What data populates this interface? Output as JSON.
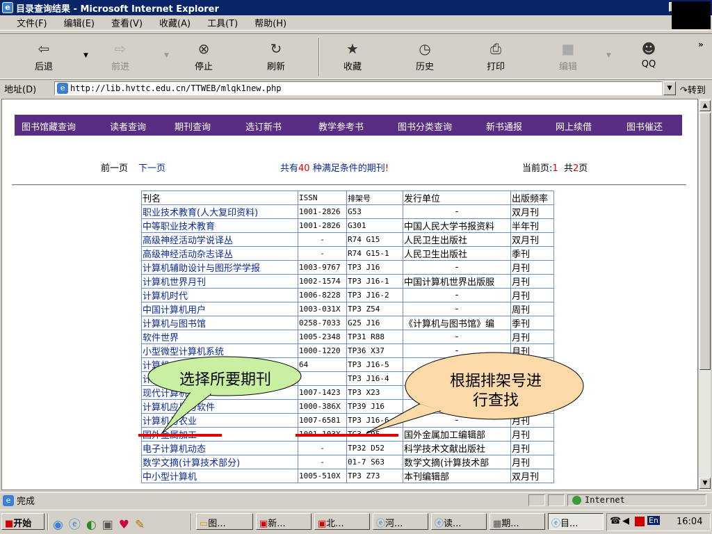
{
  "window": {
    "title": "目录查询结果 - Microsoft Internet Explorer",
    "btn_min": "_",
    "btn_max": "□",
    "btn_close": "×"
  },
  "menu": [
    "文件(F)",
    "编辑(E)",
    "查看(V)",
    "收藏(A)",
    "工具(T)",
    "帮助(H)"
  ],
  "toolbar": {
    "back": "后退",
    "forward": "前进",
    "stop": "停止",
    "refresh": "刷新",
    "favorites": "收藏",
    "history": "历史",
    "print": "打印",
    "edit": "编辑",
    "qq": "QQ",
    "more": "»"
  },
  "address": {
    "label": "地址(D)",
    "url": "http://lib.hvttc.edu.cn/TTWEB/mlqk1new.php",
    "go": "转到"
  },
  "nav": [
    "图书馆藏查询",
    "读者查询",
    "期刊查询",
    "选订新书",
    "教学参考书",
    "图书分类查询",
    "新书通报",
    "网上续借",
    "图书催还"
  ],
  "pager": {
    "prev": "前一页",
    "next": "下一页",
    "summary_pre": "共有",
    "summary_count": "40",
    "summary_post": " 种满足条件的期刊",
    "summary_mark": "!",
    "current_label": "当前页:",
    "current_page": "1",
    "total_pre": "共",
    "total_pages": "2",
    "total_post": "页"
  },
  "table": {
    "headers": [
      "刊名",
      "ISSN",
      "排架号",
      "发行单位",
      "出版频率"
    ],
    "rows": [
      [
        "职业技术教育(人大复印资料)",
        "1001-2826",
        "G53",
        "-",
        "双月刊"
      ],
      [
        "中等职业技术教育",
        "1001-2826",
        "G301",
        "中国人民大学书报资料",
        "半年刊"
      ],
      [
        "高级神经活动学说译丛",
        "-",
        "R74 G15",
        "人民卫生出版社",
        "双月刊"
      ],
      [
        "高级神经活动杂志译丛",
        "-",
        "R74 G15-1",
        "人民卫生出版社",
        "季刊"
      ],
      [
        "计算机辅助设计与图形学学报",
        "1003-9767",
        "TP3 J16",
        "-",
        "月刊"
      ],
      [
        "计算机世界月刊",
        "1002-1574",
        "TP3 J16-1",
        "中国计算机世界出版服",
        "月刊"
      ],
      [
        "计算机时代",
        "1006-8228",
        "TP3 J16-2",
        "-",
        "月刊"
      ],
      [
        "中国计算机用户",
        "1003-031X",
        "TP3 Z54",
        "-",
        "周刊"
      ],
      [
        "计算机与图书馆",
        "0258-7033",
        "G25 J16",
        "《计算机与图书馆》编",
        "季刊"
      ],
      [
        "软件世界",
        "1005-2348",
        "TP31 R88",
        "-",
        "月刊"
      ],
      [
        "小型微型计算机系统",
        "1000-1220",
        "TP36 X37",
        "-",
        "月刊"
      ],
      [
        "计算机",
        "64",
        "TP3 J16-5",
        "-",
        ""
      ],
      [
        "计算机",
        "",
        "TP3 J16-4",
        "",
        ""
      ],
      [
        "现代计算机",
        "1007-1423",
        "TP3 X23",
        "-",
        ""
      ],
      [
        "计算机应用与软件",
        "1000-386X",
        "TP39 J16",
        "",
        "月刊"
      ],
      [
        "计算机与农业",
        "1007-6581",
        "TP3 J16-6",
        "-",
        "月刊"
      ],
      [
        "国外金属加工",
        "1001-103X",
        "TG3 G95",
        "国外金属加工编辑部",
        "月刊"
      ],
      [
        "电子计算机动态",
        "-",
        "TP32 D52",
        "科学技术文献出版社",
        "月刊"
      ],
      [
        "数学文摘(计算技术部分)",
        "-",
        "01-7 S63",
        "数学文摘(计算技术部",
        "月刊"
      ],
      [
        "中小型计算机",
        "1005-510X",
        "TP3 Z73",
        "本刊编辑部",
        "双月刊"
      ]
    ]
  },
  "callouts": {
    "left": "选择所要期刊",
    "right_line1": "根据排架号进",
    "right_line2": "行查找"
  },
  "status": {
    "text": "完成",
    "zone": "Internet"
  },
  "taskbar": {
    "start": "开始",
    "items": [
      "图...",
      "新...",
      "北...",
      "河...",
      "读...",
      "期...",
      "目..."
    ],
    "clock": "16:04",
    "ime": "En"
  },
  "colors": {
    "nav_bg": "#5a2d84",
    "link": "#0a2a9a",
    "highlight": "#e00000",
    "callout_left": "#c8f0a0",
    "callout_right": "#fbd9a8"
  }
}
